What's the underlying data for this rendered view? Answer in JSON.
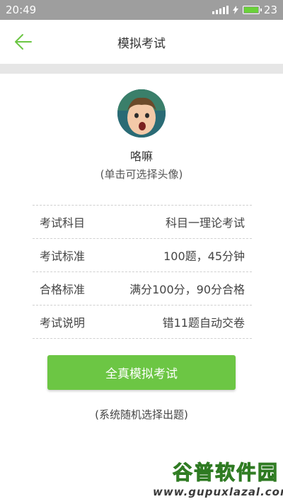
{
  "status": {
    "time": "20:49",
    "battery": "23",
    "battery_level": 1.0
  },
  "header": {
    "title": "模拟考试",
    "back_icon": "back-arrow-icon"
  },
  "profile": {
    "name": "咯嘛",
    "avatar_hint": "(单击可选择头像)"
  },
  "info": [
    {
      "label": "考试科目",
      "value": "科目一理论考试"
    },
    {
      "label": "考试标准",
      "value": "100题，45分钟"
    },
    {
      "label": "合格标准",
      "value": "满分100分，90分合格"
    },
    {
      "label": "考试说明",
      "value": "错11题自动交卷"
    }
  ],
  "cta": {
    "label": "全真模拟考试"
  },
  "note": "(系统随机选择出题)",
  "watermark": {
    "logo": "谷普软件园",
    "url": "www.gupuxlazal.com"
  },
  "colors": {
    "accent": "#6cc644",
    "statusbar": "#9e9e9e",
    "separator": "#e6e6e6"
  }
}
